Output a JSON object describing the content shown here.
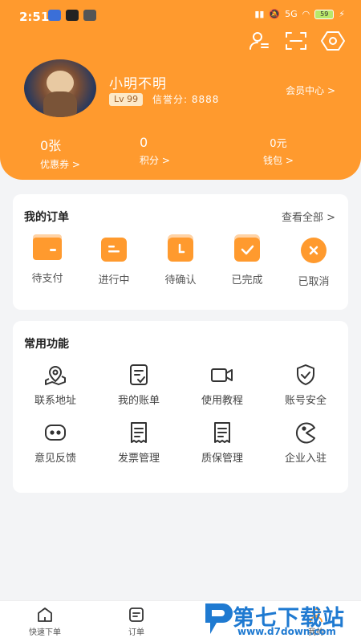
{
  "status_bar": {
    "time": "2:51",
    "network": "5G",
    "battery": "59"
  },
  "profile": {
    "name": "小明不明",
    "level": "Lv 99",
    "credit_label": "信誉分:",
    "credit_value": "8888",
    "member_center": "会员中心 >"
  },
  "stats": [
    {
      "value": "0张",
      "label": "优惠券 >"
    },
    {
      "value": "0",
      "label": "积分 >"
    },
    {
      "value": "0元",
      "label": "钱包 >"
    }
  ],
  "orders": {
    "title": "我的订单",
    "view_all": "查看全部 >",
    "items": [
      {
        "label": "待支付",
        "icon": "wallet-icon"
      },
      {
        "label": "进行中",
        "icon": "document-icon"
      },
      {
        "label": "待确认",
        "icon": "clock-icon"
      },
      {
        "label": "已完成",
        "icon": "check-icon"
      },
      {
        "label": "已取消",
        "icon": "close-circle-icon"
      }
    ]
  },
  "functions": {
    "title": "常用功能",
    "items": [
      {
        "label": "联系地址",
        "icon": "map-pin-icon"
      },
      {
        "label": "我的账单",
        "icon": "bill-icon"
      },
      {
        "label": "使用教程",
        "icon": "video-icon"
      },
      {
        "label": "账号安全",
        "icon": "shield-icon"
      },
      {
        "label": "意见反馈",
        "icon": "feedback-icon"
      },
      {
        "label": "发票管理",
        "icon": "invoice-icon"
      },
      {
        "label": "质保管理",
        "icon": "warranty-icon"
      },
      {
        "label": "企业入驻",
        "icon": "pacman-icon"
      }
    ]
  },
  "tabs": [
    {
      "label": "快速下单",
      "icon": "home-icon"
    },
    {
      "label": "订单",
      "icon": "order-icon"
    },
    {
      "label": "我的",
      "icon": "user-icon"
    }
  ],
  "watermark": {
    "text": "第七下载站",
    "url": "www.d7down.com"
  },
  "colors": {
    "accent": "#ff9a2e",
    "accent_light": "#ffd3a6",
    "background": "#f3f4f6"
  }
}
